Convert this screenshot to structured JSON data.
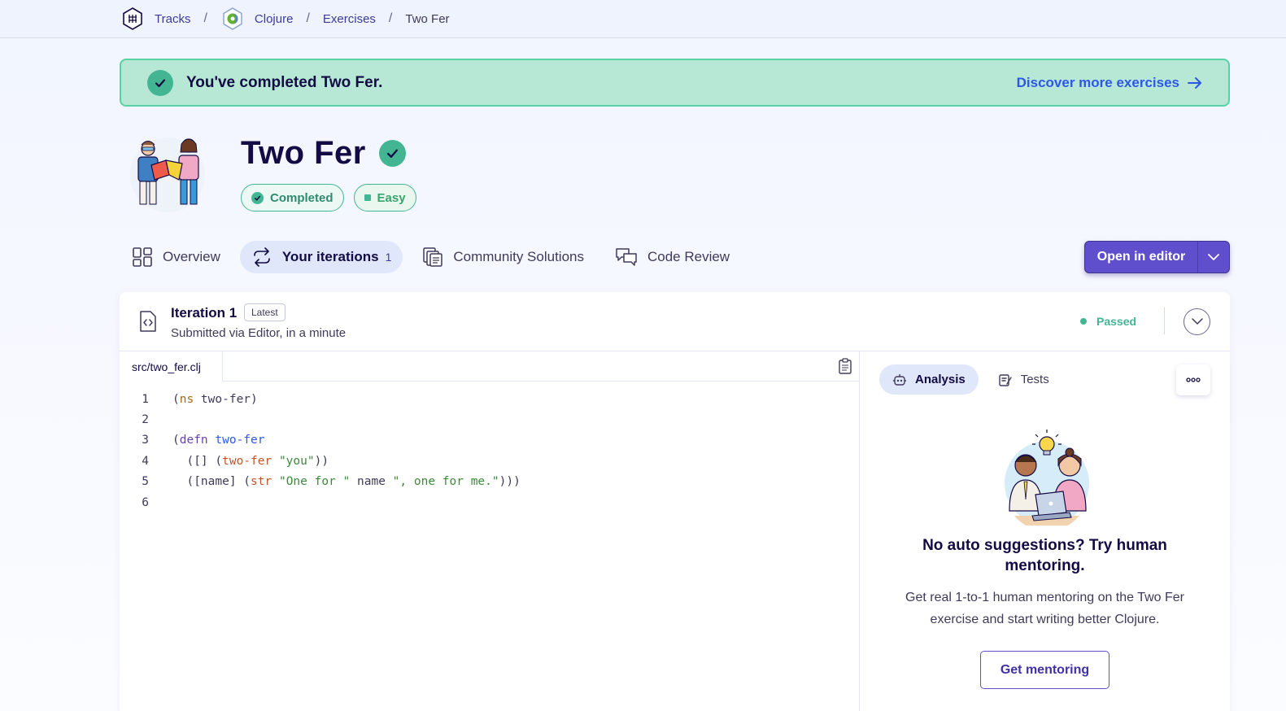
{
  "breadcrumb": {
    "tracks": "Tracks",
    "track": "Clojure",
    "exercises": "Exercises",
    "current": "Two Fer",
    "separator": "/"
  },
  "banner": {
    "message": "You've completed Two Fer.",
    "link": "Discover more exercises"
  },
  "exercise": {
    "title": "Two Fer",
    "status_tag": "Completed",
    "difficulty_tag": "Easy"
  },
  "tabs": [
    {
      "label": "Overview",
      "icon": "overview-icon"
    },
    {
      "label": "Your iterations",
      "count": "1",
      "icon": "iterations-icon"
    },
    {
      "label": "Community Solutions",
      "icon": "community-solutions-icon"
    },
    {
      "label": "Code Review",
      "icon": "code-review-icon"
    }
  ],
  "editor_button": {
    "label": "Open in editor"
  },
  "iteration": {
    "title": "Iteration 1",
    "badge": "Latest",
    "subtitle": "Submitted via Editor, in a minute",
    "status": "Passed"
  },
  "code": {
    "filename": "src/two_fer.clj",
    "lines": [
      {
        "n": "1"
      },
      {
        "n": "2"
      },
      {
        "n": "3"
      },
      {
        "n": "4"
      },
      {
        "n": "5"
      },
      {
        "n": "6"
      }
    ],
    "tokens": {
      "l1a": "(",
      "l1b": "ns",
      "l1c": " two-fer)",
      "l3a": "(",
      "l3b": "defn",
      "l3c": " ",
      "l3d": "two-fer",
      "l4a": "  ([] (",
      "l4b": "two-fer",
      "l4c": " ",
      "l4d": "\"you\"",
      "l4e": "))",
      "l5a": "  ([name] (",
      "l5b": "str",
      "l5c": " ",
      "l5d": "\"One for \"",
      "l5e": " name ",
      "l5f": "\", one for me.\"",
      "l5g": ")))"
    }
  },
  "right_panel": {
    "tabs": [
      {
        "label": "Analysis",
        "icon": "analysis-icon"
      },
      {
        "label": "Tests",
        "icon": "tests-icon"
      }
    ],
    "mentor_title": "No auto suggestions? Try human mentoring.",
    "mentor_text": "Get real 1-to-1 human mentoring on the Two Fer exercise and start writing better Clojure.",
    "mentor_button": "Get mentoring"
  },
  "colors": {
    "accent": "#604fcd",
    "success": "#43b593",
    "banner_bg": "#b7e8d6",
    "link": "#2e57e8"
  }
}
